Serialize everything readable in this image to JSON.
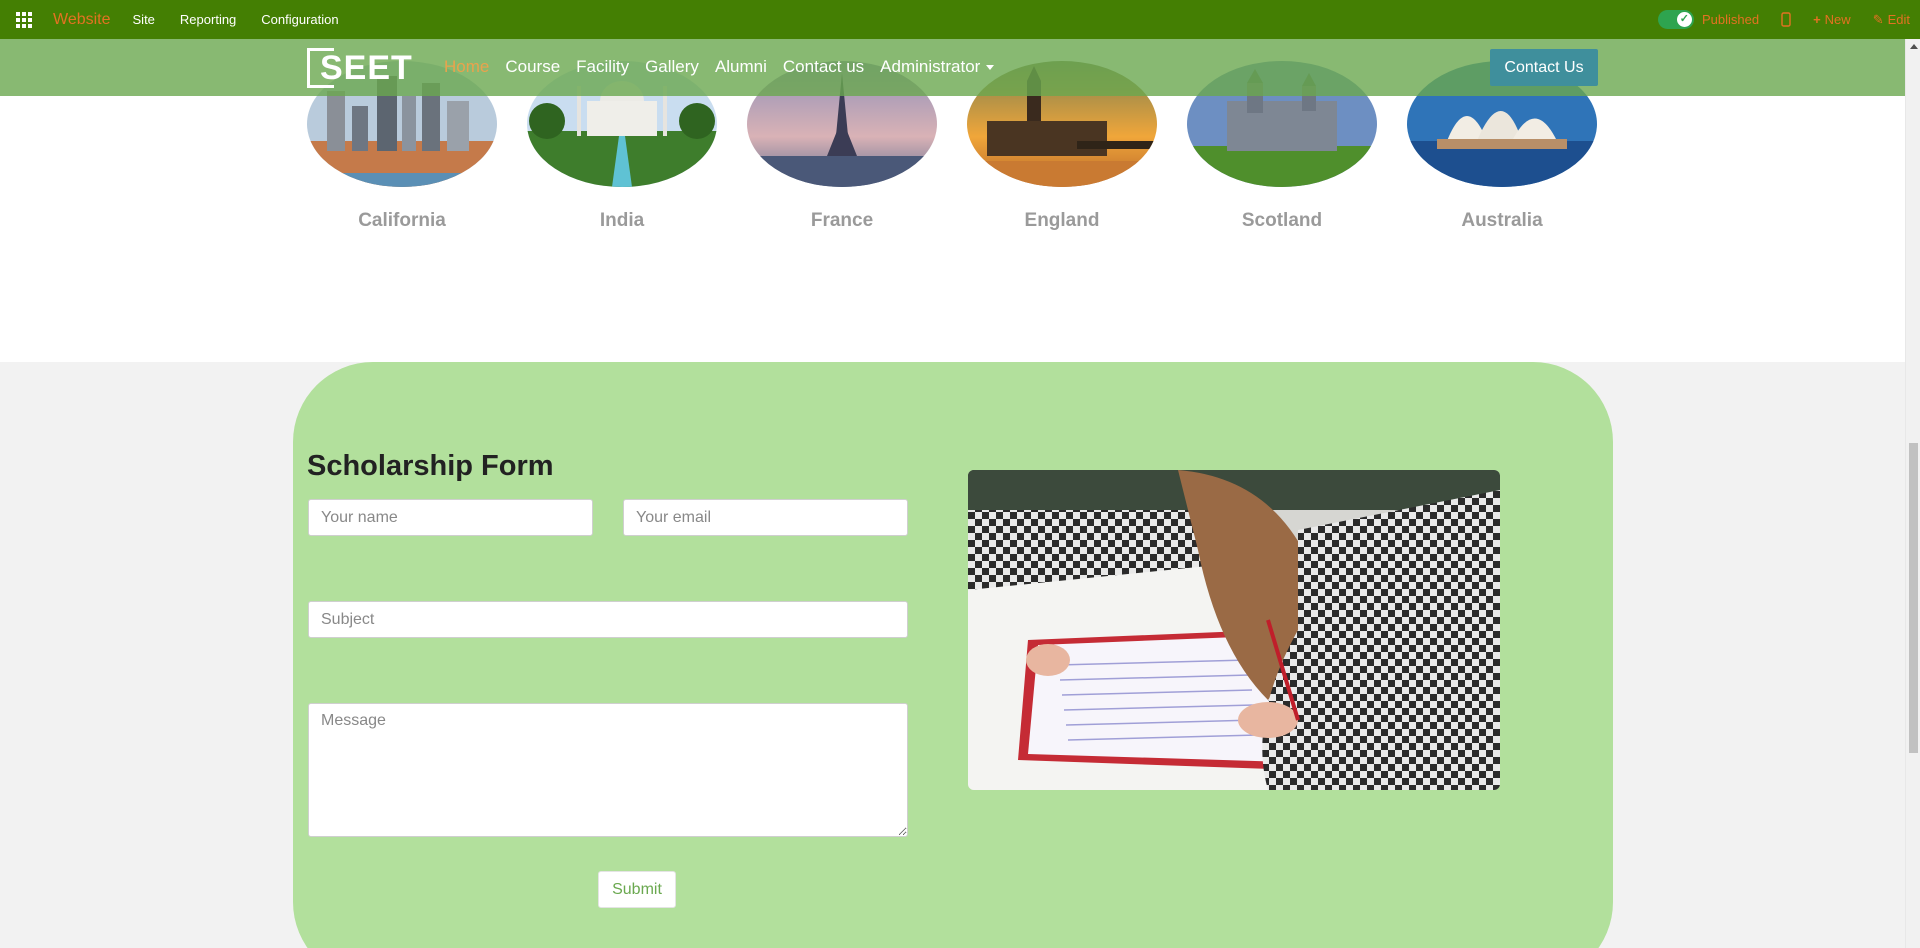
{
  "admin_bar": {
    "brand": "Website",
    "menu": [
      "Site",
      "Reporting",
      "Configuration"
    ],
    "published_label": "Published",
    "new_label": "New",
    "edit_label": "Edit"
  },
  "site_nav": {
    "logo_text": "SEET",
    "links": [
      "Home",
      "Course",
      "Facility",
      "Gallery",
      "Alumni",
      "Contact us",
      "Administrator"
    ],
    "active_link": "Home",
    "cta_label": "Contact Us"
  },
  "destinations": [
    {
      "name": "California",
      "image": "city-skyline-image"
    },
    {
      "name": "India",
      "image": "taj-mahal-image"
    },
    {
      "name": "France",
      "image": "eiffel-tower-image"
    },
    {
      "name": "England",
      "image": "big-ben-image"
    },
    {
      "name": "Scotland",
      "image": "castle-image"
    },
    {
      "name": "Australia",
      "image": "sydney-opera-house-image"
    }
  ],
  "scholarship_form": {
    "title": "Scholarship Form",
    "name_placeholder": "Your name",
    "email_placeholder": "Your email",
    "subject_placeholder": "Subject",
    "message_placeholder": "Message",
    "submit_label": "Submit",
    "photo": "student-writing-photo"
  },
  "colors": {
    "admin_bar": "#447f03",
    "accent_orange": "#e37222",
    "nav_overlay": "#6aa84f",
    "form_card": "#b2e09c",
    "cta_button": "#3f8f9c"
  }
}
